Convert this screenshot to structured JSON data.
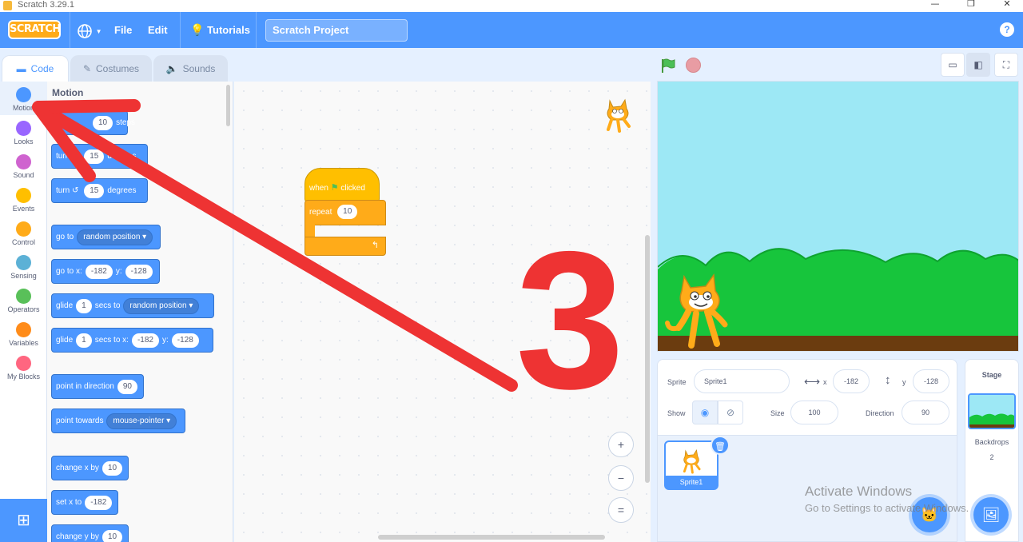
{
  "window": {
    "title": "Scratch 3.29.1",
    "controls": {
      "minimize": "—",
      "restore": "❐",
      "close": "✕"
    }
  },
  "menubar": {
    "logo": "SCRATCH",
    "language_icon": "globe-icon",
    "file": "File",
    "edit": "Edit",
    "tutorials": "Tutorials",
    "project_title": "Scratch Project",
    "help": "?"
  },
  "tabs": {
    "code": "Code",
    "costumes": "Costumes",
    "sounds": "Sounds"
  },
  "categories": [
    {
      "label": "Motion",
      "color": "#4c97ff"
    },
    {
      "label": "Looks",
      "color": "#9966ff"
    },
    {
      "label": "Sound",
      "color": "#cf63cf"
    },
    {
      "label": "Events",
      "color": "#ffbf00"
    },
    {
      "label": "Control",
      "color": "#ffab19"
    },
    {
      "label": "Sensing",
      "color": "#5cb1d6"
    },
    {
      "label": "Operators",
      "color": "#59c059"
    },
    {
      "label": "Variables",
      "color": "#ff8c1a"
    },
    {
      "label": "My Blocks",
      "color": "#ff6680"
    }
  ],
  "palette": {
    "title": "Motion",
    "move": {
      "value": "10",
      "suffix": "steps"
    },
    "turn_right": {
      "prefix": "turn",
      "value": "15",
      "suffix": "degrees"
    },
    "turn_left": {
      "prefix": "turn",
      "value": "15",
      "suffix": "degrees"
    },
    "goto": {
      "prefix": "go to",
      "option": "random position"
    },
    "goto_xy": {
      "prefix": "go to x:",
      "x": "-182",
      "ylabel": "y:",
      "y": "-128"
    },
    "glide_to": {
      "prefix": "glide",
      "value": "1",
      "mid": "secs to",
      "option": "random position"
    },
    "glide_xy": {
      "prefix": "glide",
      "value": "1",
      "mid": "secs to x:",
      "x": "-182",
      "ylabel": "y:",
      "y": "-128"
    },
    "point_dir": {
      "prefix": "point in direction",
      "value": "90"
    },
    "point_towards": {
      "prefix": "point towards",
      "option": "mouse-pointer"
    },
    "change_x": {
      "prefix": "change x by",
      "value": "10"
    },
    "set_x": {
      "prefix": "set x to",
      "value": "-182"
    },
    "change_y": {
      "prefix": "change y by",
      "value": "10"
    }
  },
  "script": {
    "hat_when": "when",
    "hat_clicked": "clicked",
    "repeat_label": "repeat",
    "repeat_value": "10"
  },
  "zoom": {
    "in": "+",
    "out": "−",
    "reset": "="
  },
  "sprite_info": {
    "sprite_label": "Sprite",
    "sprite_name": "Sprite1",
    "x_label": "x",
    "x_value": "-182",
    "y_label": "y",
    "y_value": "-128",
    "show_label": "Show",
    "size_label": "Size",
    "size_value": "100",
    "direction_label": "Direction",
    "direction_value": "90"
  },
  "sprite_list": [
    {
      "name": "Sprite1"
    }
  ],
  "stage_pane": {
    "title": "Stage",
    "backdrops_label": "Backdrops",
    "backdrops_count": "2"
  },
  "watermark": {
    "line1": "Activate Windows",
    "line2": "Go to Settings to activate Windows."
  },
  "annotation": {
    "label": "3",
    "color": "#ee3333"
  }
}
